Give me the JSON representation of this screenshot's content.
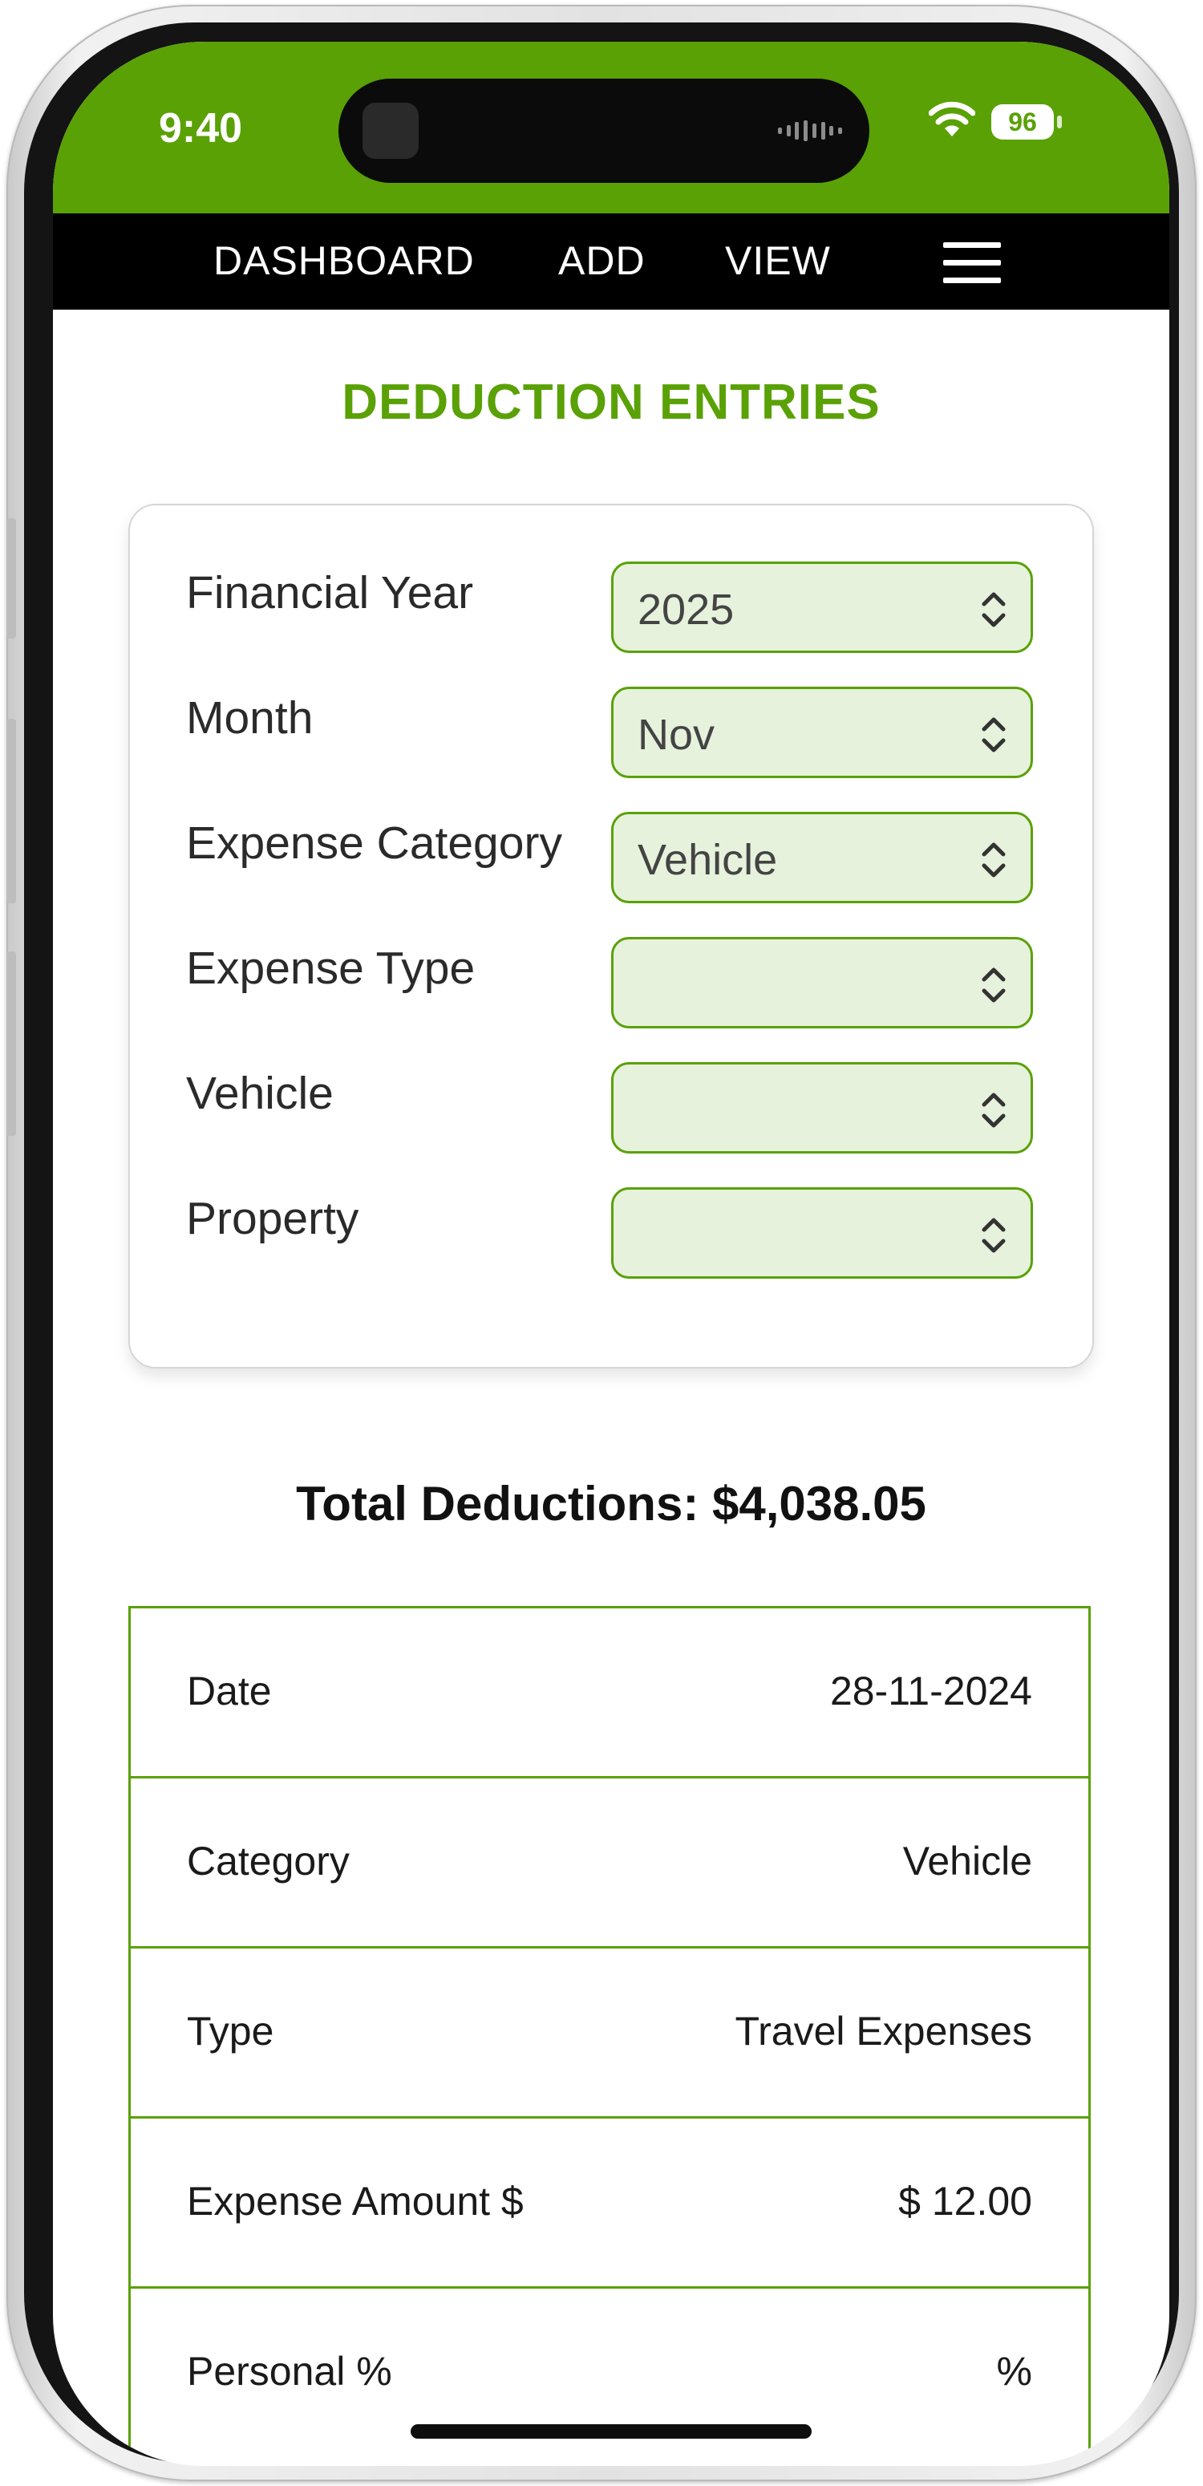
{
  "status_bar": {
    "time": "9:40",
    "battery": "96"
  },
  "nav": {
    "dashboard": "DASHBOARD",
    "add": "ADD",
    "view": "VIEW"
  },
  "page": {
    "title": "DEDUCTION ENTRIES"
  },
  "filters": [
    {
      "label": "Financial Year",
      "value": "2025"
    },
    {
      "label": "Month",
      "value": "Nov"
    },
    {
      "label": "Expense Category",
      "value": "Vehicle"
    },
    {
      "label": "Expense Type",
      "value": ""
    },
    {
      "label": "Vehicle",
      "value": ""
    },
    {
      "label": "Property",
      "value": ""
    }
  ],
  "total": {
    "text": "Total Deductions: $4,038.05"
  },
  "entry": [
    {
      "label": "Date",
      "value": "28-11-2024"
    },
    {
      "label": "Category",
      "value": "Vehicle"
    },
    {
      "label": "Type",
      "value": "Travel Expenses"
    },
    {
      "label": "Expense Amount $",
      "value": "$ 12.00"
    },
    {
      "label": "Personal %",
      "value": "%"
    }
  ],
  "colors": {
    "brand_green": "#5aa106",
    "select_fill": "#e6f2dc",
    "nav_background": "#000000"
  }
}
